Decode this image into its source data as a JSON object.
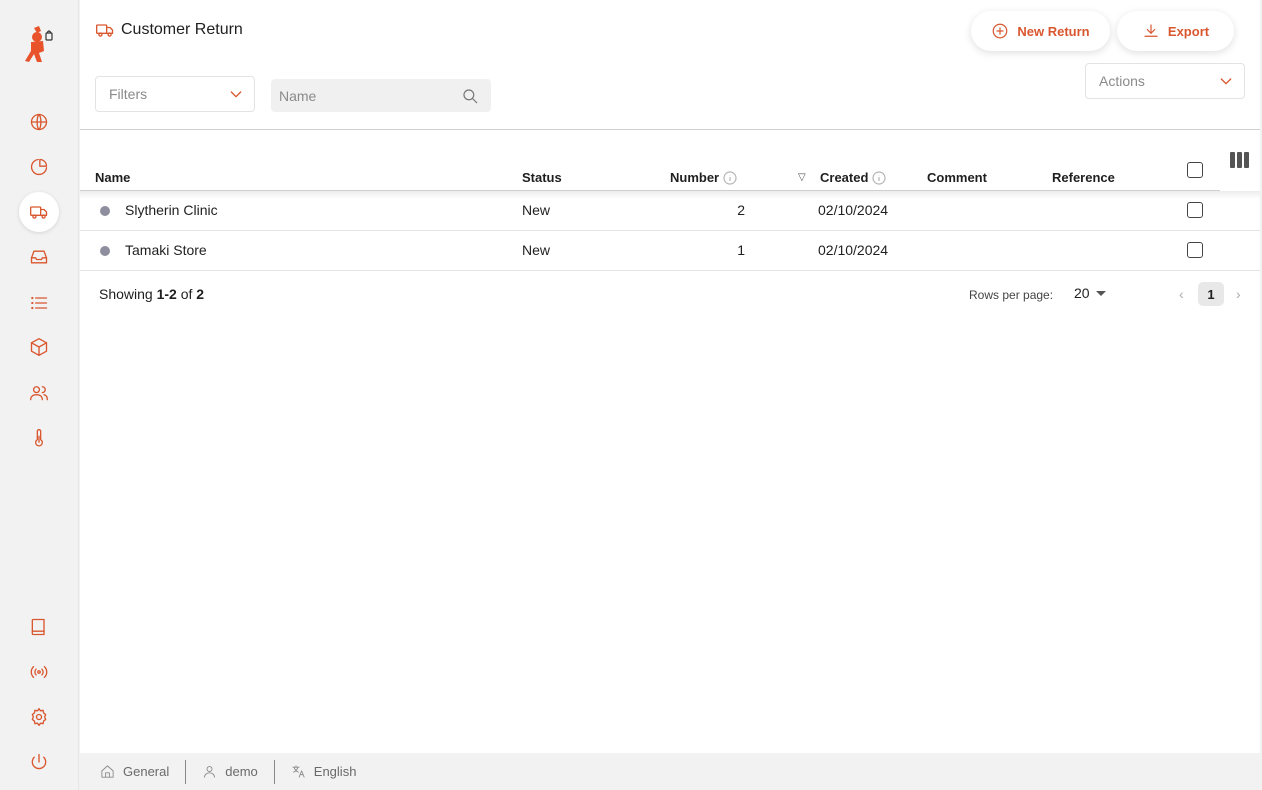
{
  "header": {
    "title": "Customer Return",
    "new_return_label": "New Return",
    "export_label": "Export"
  },
  "filters": {
    "filters_placeholder": "Filters",
    "search_placeholder": "Name",
    "actions_label": "Actions"
  },
  "table": {
    "columns": {
      "name": "Name",
      "status": "Status",
      "number": "Number",
      "created": "Created",
      "comment": "Comment",
      "reference": "Reference"
    },
    "rows": [
      {
        "name": "Slytherin Clinic",
        "status": "New",
        "number": "2",
        "created": "02/10/2024",
        "comment": "",
        "reference": ""
      },
      {
        "name": "Tamaki Store",
        "status": "New",
        "number": "1",
        "created": "02/10/2024",
        "comment": "",
        "reference": ""
      }
    ]
  },
  "pagination": {
    "showing_prefix": "Showing",
    "range": "1-2",
    "of_word": "of",
    "total": "2",
    "rows_per_page_label": "Rows per page:",
    "rows_per_page": "20",
    "current_page": "1"
  },
  "footer": {
    "workspace": "General",
    "user": "demo",
    "language": "English"
  },
  "colors": {
    "accent": "#d9572f",
    "status_dot": "#8e8e9e"
  },
  "icons": {
    "sidebar": [
      "globe-icon",
      "pie-chart-icon",
      "truck-icon",
      "inbox-icon",
      "list-icon",
      "package-icon",
      "users-icon",
      "thermometer-icon",
      "book-icon",
      "broadcast-icon",
      "gear-icon",
      "power-icon"
    ]
  }
}
